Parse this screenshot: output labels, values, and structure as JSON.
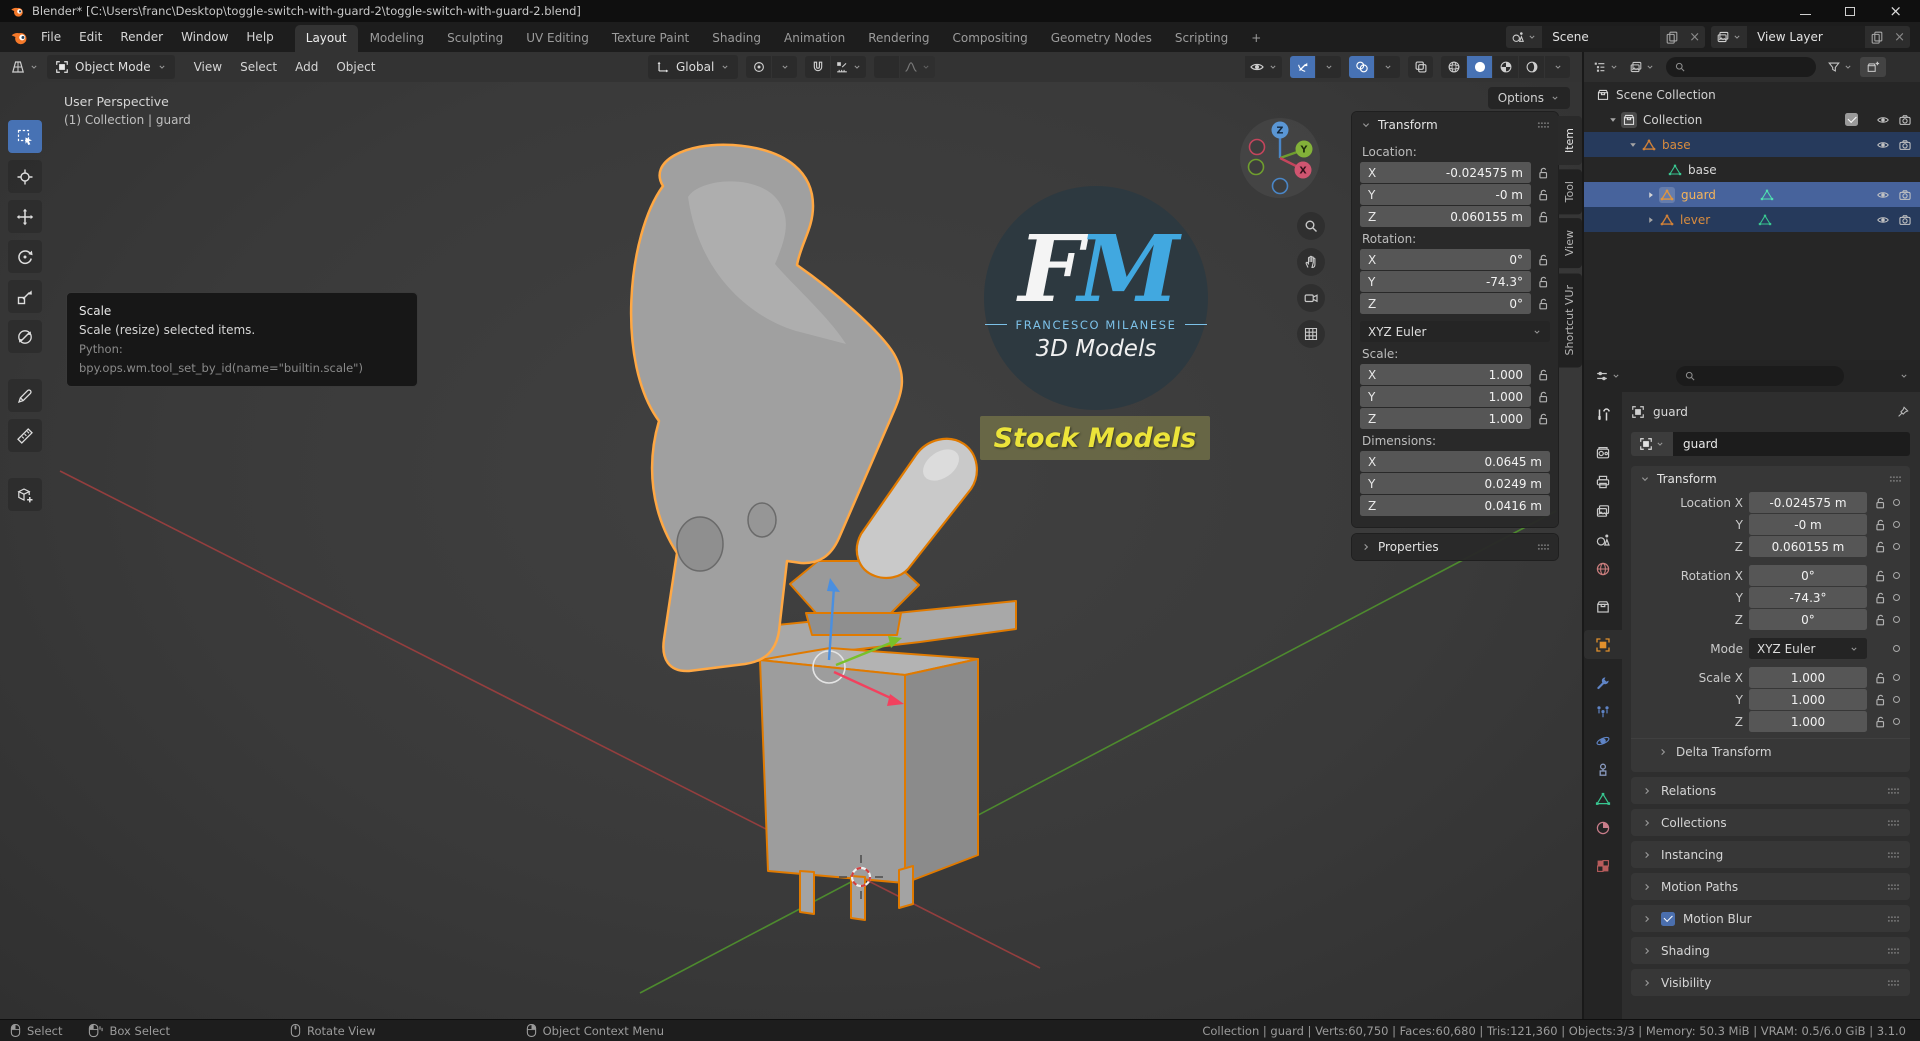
{
  "window": {
    "title": "Blender* [C:\\Users\\franc\\Desktop\\toggle-switch-with-guard-2\\toggle-switch-with-guard-2.blend]"
  },
  "topbar": {
    "menus": [
      "File",
      "Edit",
      "Render",
      "Window",
      "Help"
    ],
    "workspaces": [
      "Layout",
      "Modeling",
      "Sculpting",
      "UV Editing",
      "Texture Paint",
      "Shading",
      "Animation",
      "Rendering",
      "Compositing",
      "Geometry Nodes",
      "Scripting"
    ],
    "add_workspace": "+",
    "scene_label": "Scene",
    "view_layer_label": "View Layer"
  },
  "tool_header": {
    "mode": "Object Mode",
    "menus": [
      "View",
      "Select",
      "Add",
      "Object"
    ],
    "orientation": "Global",
    "options_label": "Options"
  },
  "viewport": {
    "perspective_label": "User Perspective",
    "context_label": "(1) Collection | guard",
    "tooltip": {
      "title": "Scale",
      "description": "Scale (resize) selected items.",
      "python": "Python: bpy.ops.wm.tool_set_by_id(name=\"builtin.scale\")"
    },
    "watermark": {
      "initials_f": "F",
      "initials_m": "M",
      "name": "FRANCESCO MILANESE",
      "subtitle": "3D Models",
      "banner": "Stock Models"
    },
    "gizmo_axes": {
      "x": "X",
      "y": "Y",
      "z": "Z"
    }
  },
  "sidebar_tabs": [
    {
      "label": "Item"
    },
    {
      "label": "Tool"
    },
    {
      "label": "View"
    },
    {
      "label": "Shortcut VUr"
    }
  ],
  "n_panel": {
    "transform_title": "Transform",
    "location_label": "Location:",
    "rotation_label": "Rotation:",
    "scale_label": "Scale:",
    "dimensions_label": "Dimensions:",
    "rotation_mode": "XYZ Euler",
    "properties_title": "Properties",
    "rows": {
      "loc_x_axis": "X",
      "loc_x": "-0.024575 m",
      "loc_y_axis": "Y",
      "loc_y": "-0 m",
      "loc_z_axis": "Z",
      "loc_z": "0.060155 m",
      "rot_x_axis": "X",
      "rot_x": "0°",
      "rot_y_axis": "Y",
      "rot_y": "-74.3°",
      "rot_z_axis": "Z",
      "rot_z": "0°",
      "scale_x_axis": "X",
      "scale_x": "1.000",
      "scale_y_axis": "Y",
      "scale_y": "1.000",
      "scale_z_axis": "Z",
      "scale_z": "1.000",
      "dim_x_axis": "X",
      "dim_x": "0.0645 m",
      "dim_y_axis": "Y",
      "dim_y": "0.0249 m",
      "dim_z_axis": "Z",
      "dim_z": "0.0416 m"
    }
  },
  "outliner": {
    "rows": [
      {
        "label": "Scene Collection"
      },
      {
        "label": "Collection"
      },
      {
        "label": "base"
      },
      {
        "label": "base"
      },
      {
        "label": "guard"
      },
      {
        "label": "lever"
      }
    ]
  },
  "properties": {
    "breadcrumb": "guard",
    "name_value": "guard",
    "transform_title": "Transform",
    "fields": {
      "loc_label": "Location X",
      "loc_y_label": "Y",
      "loc_z_label": "Z",
      "rot_label": "Rotation X",
      "rot_y_label": "Y",
      "rot_z_label": "Z",
      "mode_label": "Mode",
      "scale_label": "Scale X",
      "scale_y_label": "Y",
      "scale_z_label": "Z",
      "loc_x": "-0.024575 m",
      "loc_y": "-0 m",
      "loc_z": "0.060155 m",
      "rot_x": "0°",
      "rot_y": "-74.3°",
      "rot_z": "0°",
      "mode_value": "XYZ Euler",
      "scale_x": "1.000",
      "scale_y": "1.000",
      "scale_z": "1.000"
    },
    "sub_panel": "Delta Transform",
    "panels_a": [
      "Relations",
      "Collections",
      "Instancing",
      "Motion Paths"
    ],
    "motion_blur": "Motion Blur",
    "panels_b": [
      "Shading",
      "Visibility"
    ]
  },
  "status_bar": {
    "items": [
      {
        "label": "Select"
      },
      {
        "label": "Box Select"
      },
      {
        "label": "Rotate View"
      },
      {
        "label": "Object Context Menu"
      }
    ],
    "stats": "Collection | guard | Verts:60,750 | Faces:60,680 | Tris:121,360 | Objects:3/3 | Memory: 50.3 MiB | VRAM: 0.5/6.0 GiB | 3.1.0"
  }
}
